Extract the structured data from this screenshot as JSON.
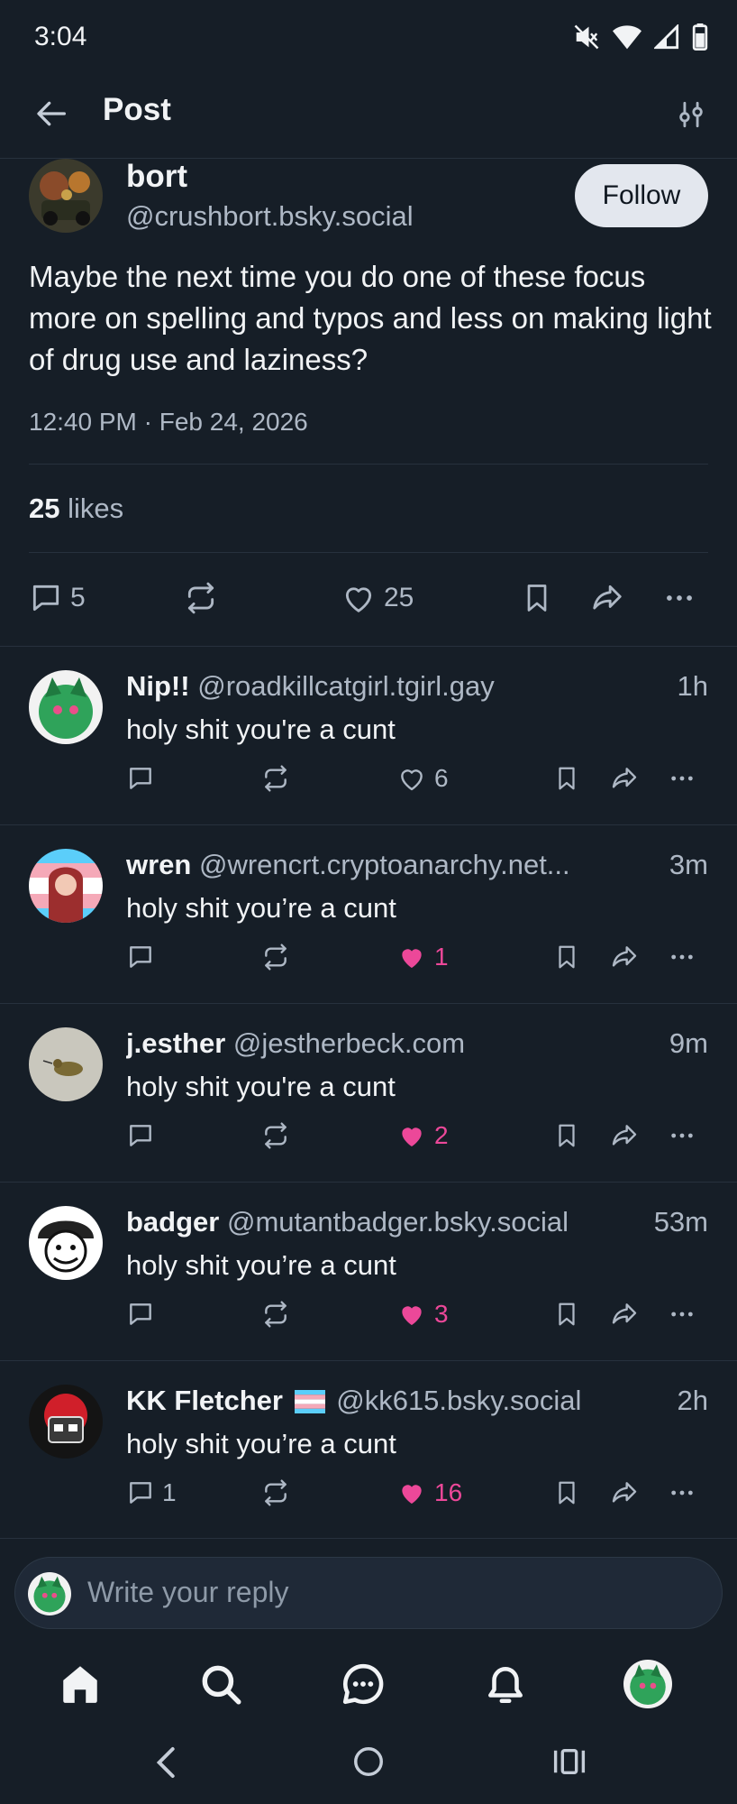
{
  "status_bar": {
    "time": "3:04",
    "icons": [
      "mute-icon",
      "wifi-icon",
      "signal-icon",
      "battery-icon"
    ]
  },
  "header": {
    "title": "Post",
    "back_icon": "arrow-left-icon",
    "filter_icon": "sliders-icon"
  },
  "post": {
    "author_name": "bort",
    "author_handle": "@crushbort.bsky.social",
    "follow_label": "Follow",
    "text": "Maybe the next time you do one of these focus more on spelling and typos and less on making light of drug use and laziness?",
    "timestamp": "12:40 PM · Feb 24, 2026",
    "likes_count": "25",
    "likes_label": "likes",
    "reply_count": "5",
    "like_count": "25"
  },
  "replies": [
    {
      "name": "Nip!!",
      "handle": "@roadkillcatgirl.tgirl.gay",
      "ago": "1h",
      "text": "holy shit you're a cunt",
      "reply_count": "",
      "like_count": "6",
      "liked": false
    },
    {
      "name": "wren",
      "handle": "@wrencrt.cryptoanarchy.net...",
      "ago": "3m",
      "text": "holy shit you’re a cunt",
      "reply_count": "",
      "like_count": "1",
      "liked": true
    },
    {
      "name": "j.esther",
      "handle": "@jestherbeck.com",
      "ago": "9m",
      "text": "holy shit you're a cunt",
      "reply_count": "",
      "like_count": "2",
      "liked": true
    },
    {
      "name": "badger",
      "handle": "@mutantbadger.bsky.social",
      "ago": "53m",
      "text": "holy shit you’re a cunt",
      "reply_count": "",
      "like_count": "3",
      "liked": true
    },
    {
      "name": "KK Fletcher",
      "flag": "transgender-flag",
      "handle": "@kk615.bsky.social",
      "ago": "2h",
      "text": "holy shit you’re a cunt",
      "reply_count": "1",
      "like_count": "16",
      "liked": true
    }
  ],
  "composer": {
    "placeholder": "Write your reply"
  },
  "bottom_nav": [
    "home-icon",
    "search-icon",
    "chat-icon",
    "bell-icon",
    "profile-avatar"
  ],
  "system_nav": [
    "back-icon",
    "home-circle-icon",
    "recents-icon"
  ],
  "colors": {
    "background": "#161e27",
    "divider": "#27313d",
    "muted_text": "#aeb8c5",
    "like_pink": "#ec4899",
    "follow_bg": "#e3e7ee"
  }
}
